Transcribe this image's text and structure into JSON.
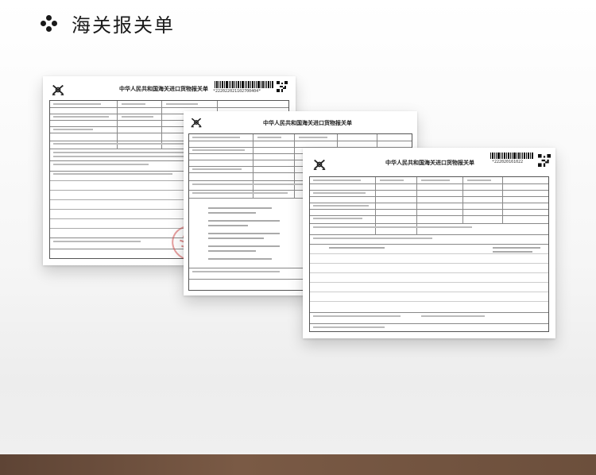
{
  "header": {
    "title": "海关报关单",
    "icon": "four-dot-icon"
  },
  "documents": [
    {
      "title": "中华人民共和国海关进口货物报关单",
      "barcode_number": "*222022021102700404*"
    },
    {
      "title": "中华人民共和国海关进口货物报关单"
    },
    {
      "title": "中华人民共和国海关进口货物报关单",
      "barcode_number": "*222020161022"
    }
  ],
  "colors": {
    "bottom_bar": "#6c4f3c",
    "stamp": "#d05050",
    "ink": "#1a1a1a"
  }
}
